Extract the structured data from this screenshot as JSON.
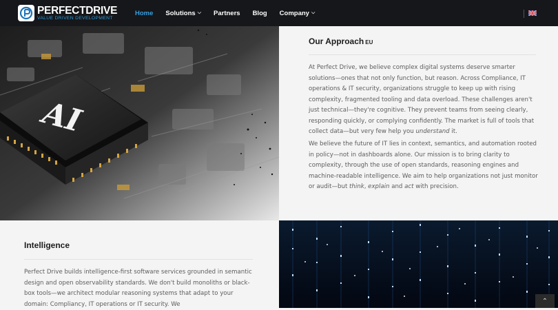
{
  "brand": {
    "name_part1": "PERFECT",
    "name_part2": "DRIVE",
    "tagline": "VALUE DRIVEN DEVELOPMENT"
  },
  "nav": {
    "items": [
      {
        "label": "Home",
        "active": true,
        "dropdown": false
      },
      {
        "label": "Solutions",
        "active": false,
        "dropdown": true
      },
      {
        "label": "Partners",
        "active": false,
        "dropdown": false
      },
      {
        "label": "Blog",
        "active": false,
        "dropdown": false
      },
      {
        "label": "Company",
        "active": false,
        "dropdown": true
      }
    ],
    "language_icon": "uk-flag-icon"
  },
  "approach": {
    "title": "Our Approach",
    "title_suffix": "EU",
    "p1_main": "At Perfect Drive, we believe complex digital systems deserve smarter solutions—ones that not only function, but reason. Across Compliance, IT operations & IT security, organizations struggle to keep up with rising complexity, fragmented tooling and data overload. These challenges aren't just technical—they're cognitive. They prevent teams from seeing clearly, responding quickly, or complying confidently. The market is full of tools that collect data—but very few help you ",
    "p1_em": "understand",
    "p1_end": " it.",
    "p2_main": "We believe the future of IT lies in context, semantics, and automation rooted in policy—not in dashboards alone. Our mission is to bring clarity to complexity, through the use of open standards, reasoning engines and machine-readable intelligence. We aim to help organizations not just monitor or audit—but ",
    "p2_em1": "think",
    "p2_sep1": ", ",
    "p2_em2": "explain",
    "p2_sep2": " and ",
    "p2_em3": "act",
    "p2_end": " with precision."
  },
  "intelligence": {
    "title": "Intelligence",
    "p1": "Perfect Drive builds intelligence-first software services grounded in semantic design and open observability standards. We don't build monoliths or black-box tools—we architect modular reasoning systems that adapt to your domain: Compliancy, IT operations or IT security. We"
  },
  "images": {
    "chip_label": "AI"
  },
  "colors": {
    "accent": "#3a9fe0",
    "nav_bg": "#15171a",
    "panel_bg": "#f4f4f4"
  },
  "scroll_top_icon": "chevron-up-icon"
}
